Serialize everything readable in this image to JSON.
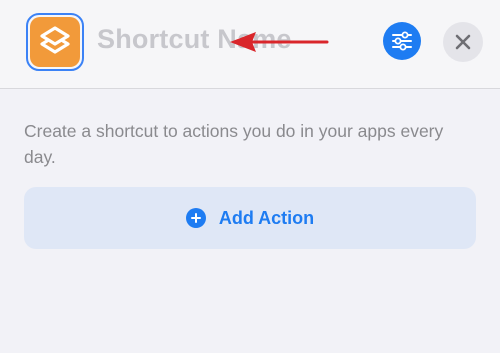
{
  "header": {
    "name_placeholder": "Shortcut Name",
    "app_icon": "shortcuts-layers-icon",
    "settings_icon": "sliders-icon",
    "close_icon": "close-icon"
  },
  "main": {
    "description": "Create a shortcut to actions you do in your apps every day.",
    "add_action_label": "Add Action",
    "add_action_icon": "plus-circle-icon"
  },
  "colors": {
    "accent": "#1e7cf2",
    "icon_background": "#f29a3a",
    "annotation_arrow": "#d9262b"
  }
}
